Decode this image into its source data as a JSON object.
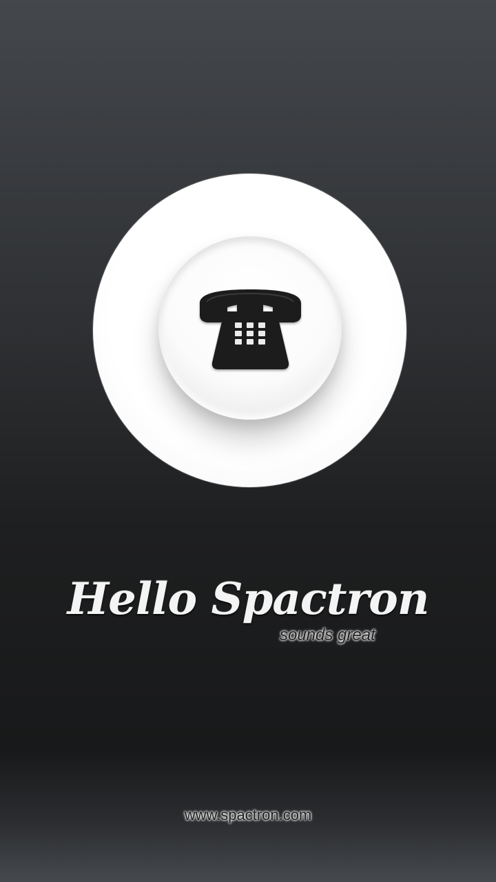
{
  "splash": {
    "title": "Hello Spactron",
    "subtitle": "sounds great",
    "website": "www.spactron.com",
    "icon": "telephone-icon"
  },
  "colors": {
    "background_top": "#44474c",
    "background_mid": "#1e1f20",
    "background_bottom": "#46494e",
    "disc": "#ffffff",
    "icon": "#1e1e1e",
    "title_text": "#f4f4f4"
  }
}
